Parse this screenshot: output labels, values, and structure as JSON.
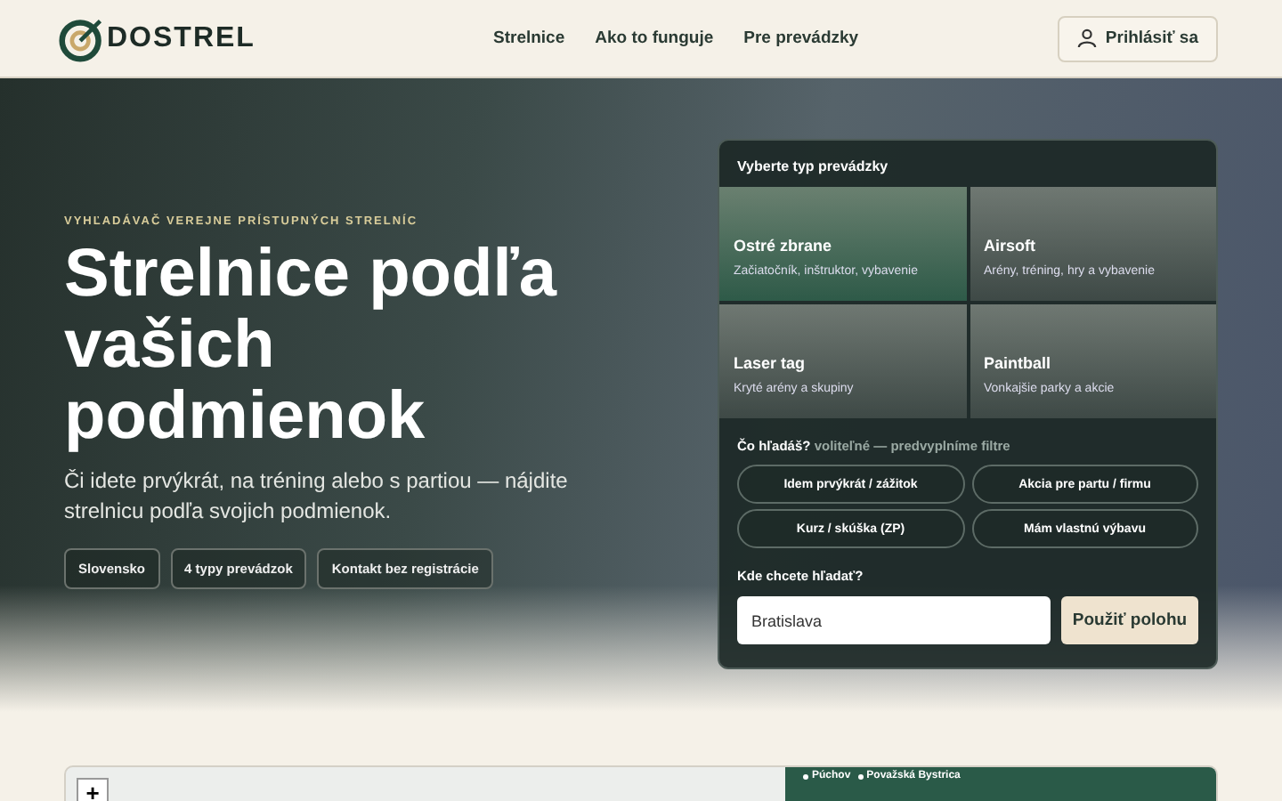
{
  "header": {
    "logo": "DOSTREL",
    "nav": [
      {
        "label": "Strelnice"
      },
      {
        "label": "Ako to funguje"
      },
      {
        "label": "Pre prevádzky"
      }
    ],
    "login": "Prihlásiť sa"
  },
  "hero": {
    "eyebrow": "VYHĽADÁVAČ VEREJNE PRÍSTUPNÝCH STRELNÍC",
    "title": "Strelnice podľa vašich podmienok",
    "subtitle": "Či idete prvýkrát, na tréning alebo s partiou — nájdite strelnicu podľa svojich podmienok.",
    "badges": [
      "Slovensko",
      "4 typy prevádzok",
      "Kontakt bez registrácie"
    ]
  },
  "panel": {
    "title": "Vyberte typ prevádzky",
    "types": [
      {
        "name": "Ostré zbrane",
        "desc": "Začiatočník, inštruktor, vybavenie",
        "selected": true
      },
      {
        "name": "Airsoft",
        "desc": "Arény, tréning, hry a vybavenie",
        "selected": false
      },
      {
        "name": "Laser tag",
        "desc": "Kryté arény a skupiny",
        "selected": false
      },
      {
        "name": "Paintball",
        "desc": "Vonkajšie parky a akcie",
        "selected": false
      }
    ],
    "purpose_label": "Čo hľadáš?",
    "purpose_hint": "voliteľné — predvyplníme filtre",
    "purposes": [
      {
        "label": "Idem prvýkrát / zážitok",
        "selected": false
      },
      {
        "label": "Akcia pre partu / firmu",
        "selected": false
      },
      {
        "label": "Kurz / skúška (ZP)",
        "selected": false
      },
      {
        "label": "Mám vlastnú výbavu",
        "selected": false
      }
    ],
    "location_label": "Kde chcete hľadať?",
    "location_value": "Bratislava",
    "location_button": "Použiť polohu"
  },
  "map": {
    "zoom_in": "+",
    "places": [
      "Púchov",
      "Považská Bystrica"
    ]
  }
}
